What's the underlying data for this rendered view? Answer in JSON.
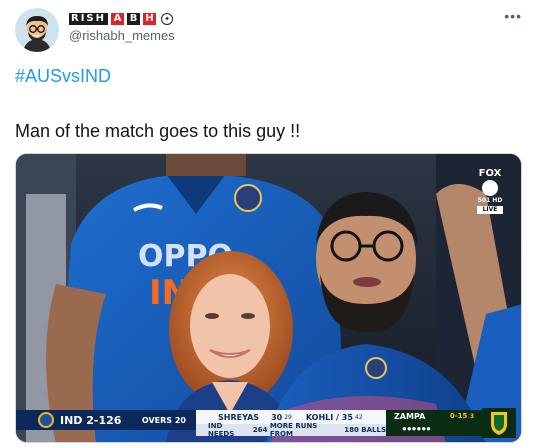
{
  "tweet": {
    "display_name_letters": [
      "R",
      "I",
      "S",
      "H",
      "A",
      "B",
      "H"
    ],
    "display_name_part1": "RISH",
    "display_name_part2": [
      "A",
      "B",
      "H"
    ],
    "handle": "@rishabh_memes",
    "more_icon": "more-dots-icon",
    "hashtag": "#AUSvsIND",
    "text": "Man of the match goes to this guy !!"
  },
  "media": {
    "broadcaster_top": "FOX",
    "broadcaster_sub": "501 HD",
    "live_label": "LIVE",
    "scoreboard": {
      "batting_team": "IND 2-126",
      "overs": "OVERS 20",
      "batter1_name": "SHREYAS",
      "batter1_runs": "30",
      "batter1_balls": "29",
      "batter2_name": "KOHLI",
      "batter2_runs": "35",
      "batter2_balls": "42",
      "need_prefix": "IND NEEDS",
      "need_runs": "264",
      "need_middle": "MORE RUNS FROM",
      "need_balls": "180",
      "need_suffix": "BALLS",
      "bowler_name": "ZAMPA",
      "bowler_figures": "0-15",
      "bowler_overs": "3",
      "ball_dots": "●●●●●●"
    }
  }
}
